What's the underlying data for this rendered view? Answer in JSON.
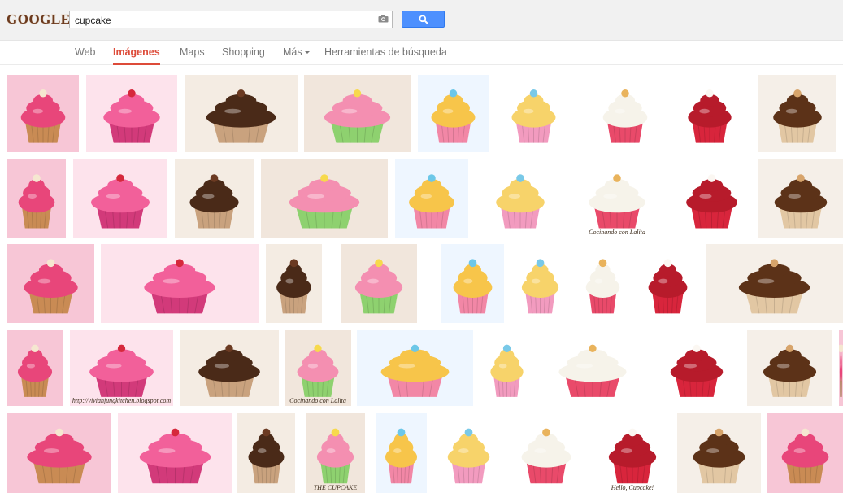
{
  "header": {
    "logo_text": "GOOGLE",
    "search_value": "cupcake",
    "search_icon": "magnifier-icon",
    "camera_icon": "camera-icon",
    "accent_color": "#4d90fe"
  },
  "nav": {
    "tabs": [
      {
        "label": "Web",
        "active": false
      },
      {
        "label": "Imágenes",
        "active": true
      },
      {
        "label": "Maps",
        "active": false
      },
      {
        "label": "Shopping",
        "active": false
      },
      {
        "label": "Más",
        "active": false,
        "has_dropdown": true
      },
      {
        "label": "Herramientas de búsqueda",
        "active": false
      }
    ],
    "active_color": "#dd4b39"
  },
  "results": {
    "rows": [
      [
        {
          "subject": "pink frosted cupcake"
        },
        {
          "subject": "pink cupcakes with star toppers"
        },
        {
          "subject": "chocolate cupcakes"
        },
        {
          "subject": "decorated cupcakes with wafers"
        },
        {
          "subject": "cupcake tower"
        },
        {
          "subject": "small cupcake stand"
        },
        {
          "subject": "vanilla cupcake with sprinkles"
        },
        {
          "subject": "red velvet cupcake with raspberry"
        },
        {
          "subject": "chocolate frosted cupcake"
        }
      ],
      [
        {
          "subject": "pink frosted cupcake"
        },
        {
          "subject": "chocolate cupcake with banana"
        },
        {
          "subject": "box of pastel cupcakes"
        },
        {
          "subject": "cookie monster cupcake"
        },
        {
          "subject": "cupcake illustration"
        },
        {
          "subject": "cupcake frames clipart"
        },
        {
          "subject": "caramel frosting",
          "caption": "Cocinando con Lalita"
        },
        {
          "subject": "pink cupcakes with black toppers"
        },
        {
          "subject": "cupcake book"
        }
      ],
      [
        {
          "subject": "raspberry cupcake"
        },
        {
          "subject": "assorted animal cupcakes"
        },
        {
          "subject": "pink sprinkle cupcake"
        },
        {
          "subject": "cupcake plate"
        },
        {
          "subject": "patterned cupcake cutout"
        },
        {
          "subject": "chocolate swirl cupcake"
        },
        {
          "subject": "framed pink cupcakes"
        },
        {
          "subject": "cupcake gift wrap"
        },
        {
          "subject": "baker with cupcakes"
        }
      ],
      [
        {
          "subject": "birthday cupcake with candle"
        },
        {
          "subject": "chocolate chip muffin",
          "caption": "http://vivianjungkitchen.blogspot.com"
        },
        {
          "subject": "face cupcake"
        },
        {
          "subject": "giraffe cupcake",
          "caption": "Cocinando con Lalita"
        },
        {
          "subject": "chocolate cupcakes with cream"
        },
        {
          "subject": "mini cupcakes on plate"
        },
        {
          "subject": "cupcake pattern"
        },
        {
          "subject": "raspberry topped cupcake"
        },
        {
          "subject": "pink frosted cupcake"
        }
      ],
      [
        {
          "subject": "sleeping girl cupcake"
        },
        {
          "subject": "oreo cupcakes"
        },
        {
          "subject": "muffins with strawberries"
        },
        {
          "subject": "cupcake logo",
          "caption": "THE CUPCAKE"
        },
        {
          "subject": "cupcake stand"
        },
        {
          "subject": "cupcake wallpaper"
        },
        {
          "subject": "pink swirl cupcake"
        },
        {
          "subject": "puppy cupcakes",
          "caption": "Hello, Cupcake!"
        },
        {
          "subject": "cupcake party table"
        },
        {
          "subject": "cupcake card"
        }
      ]
    ]
  }
}
